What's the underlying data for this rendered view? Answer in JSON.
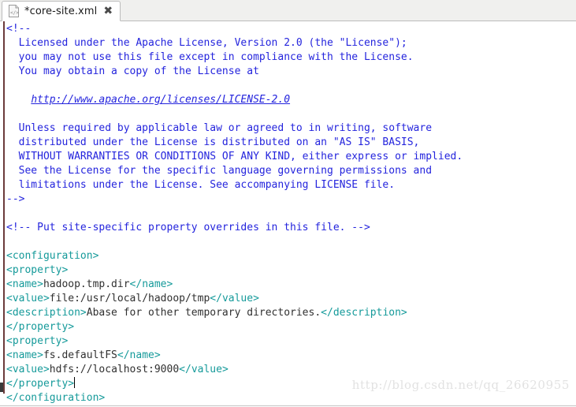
{
  "window": {
    "title": "*core-site.xml"
  },
  "tabbar": {
    "tab": {
      "label": "*core-site.xml",
      "icon": "xml-file-icon",
      "close_label": "✖",
      "modified": true
    }
  },
  "editor": {
    "language": "xml",
    "colors": {
      "comment": "#2424dd",
      "tag": "#159a9a",
      "text": "#303030",
      "link": "#2424dd",
      "background": "#ffffff",
      "gutter_rule": "#6b3b3b"
    },
    "lines": [
      {
        "n": 1,
        "segments": [
          {
            "cls": "cm",
            "t": "<!--"
          }
        ]
      },
      {
        "n": 2,
        "segments": [
          {
            "cls": "cm",
            "t": "  Licensed under the Apache License, Version 2.0 (the \"License\");"
          }
        ]
      },
      {
        "n": 3,
        "segments": [
          {
            "cls": "cm",
            "t": "  you may not use this file except in compliance with the License."
          }
        ]
      },
      {
        "n": 4,
        "segments": [
          {
            "cls": "cm",
            "t": "  You may obtain a copy of the License at"
          }
        ]
      },
      {
        "n": 5,
        "segments": [
          {
            "cls": "cm",
            "t": ""
          }
        ]
      },
      {
        "n": 6,
        "segments": [
          {
            "cls": "cm",
            "t": "    "
          },
          {
            "cls": "link",
            "t": "http://www.apache.org/licenses/LICENSE-2.0"
          }
        ]
      },
      {
        "n": 7,
        "segments": [
          {
            "cls": "cm",
            "t": ""
          }
        ]
      },
      {
        "n": 8,
        "segments": [
          {
            "cls": "cm",
            "t": "  Unless required by applicable law or agreed to in writing, software"
          }
        ]
      },
      {
        "n": 9,
        "segments": [
          {
            "cls": "cm",
            "t": "  distributed under the License is distributed on an \"AS IS\" BASIS,"
          }
        ]
      },
      {
        "n": 10,
        "segments": [
          {
            "cls": "cm",
            "t": "  WITHOUT WARRANTIES OR CONDITIONS OF ANY KIND, either express or implied."
          }
        ]
      },
      {
        "n": 11,
        "segments": [
          {
            "cls": "cm",
            "t": "  See the License for the specific language governing permissions and"
          }
        ]
      },
      {
        "n": 12,
        "segments": [
          {
            "cls": "cm",
            "t": "  limitations under the License. See accompanying LICENSE file."
          }
        ]
      },
      {
        "n": 13,
        "segments": [
          {
            "cls": "cm",
            "t": "-->"
          }
        ]
      },
      {
        "n": 14,
        "segments": [
          {
            "cls": "cm",
            "t": ""
          }
        ]
      },
      {
        "n": 15,
        "segments": [
          {
            "cls": "cm",
            "t": "<!-- Put site-specific property overrides in this file. -->"
          }
        ]
      },
      {
        "n": 16,
        "segments": [
          {
            "cls": "cm",
            "t": ""
          }
        ]
      },
      {
        "n": 17,
        "segments": [
          {
            "cls": "tag",
            "t": "<configuration>"
          }
        ]
      },
      {
        "n": 18,
        "segments": [
          {
            "cls": "tag",
            "t": "<property>"
          }
        ]
      },
      {
        "n": 19,
        "segments": [
          {
            "cls": "tag",
            "t": "<name>"
          },
          {
            "cls": "txt",
            "t": "hadoop.tmp.dir"
          },
          {
            "cls": "tag",
            "t": "</name>"
          }
        ]
      },
      {
        "n": 20,
        "segments": [
          {
            "cls": "tag",
            "t": "<value>"
          },
          {
            "cls": "txt",
            "t": "file:/usr/local/hadoop/tmp"
          },
          {
            "cls": "tag",
            "t": "</value>"
          }
        ]
      },
      {
        "n": 21,
        "segments": [
          {
            "cls": "tag",
            "t": "<description>"
          },
          {
            "cls": "txt",
            "t": "Abase for other temporary directories."
          },
          {
            "cls": "tag",
            "t": "</description>"
          }
        ]
      },
      {
        "n": 22,
        "segments": [
          {
            "cls": "tag",
            "t": "</property>"
          }
        ]
      },
      {
        "n": 23,
        "segments": [
          {
            "cls": "tag",
            "t": "<property>"
          }
        ]
      },
      {
        "n": 24,
        "segments": [
          {
            "cls": "tag",
            "t": "<name>"
          },
          {
            "cls": "txt",
            "t": "fs.defaultFS"
          },
          {
            "cls": "tag",
            "t": "</name>"
          }
        ]
      },
      {
        "n": 25,
        "segments": [
          {
            "cls": "tag",
            "t": "<value>"
          },
          {
            "cls": "txt",
            "t": "hdfs://localhost:9000"
          },
          {
            "cls": "tag",
            "t": "</value>"
          }
        ]
      },
      {
        "n": 26,
        "segments": [
          {
            "cls": "tag",
            "t": "</property>"
          }
        ],
        "caret_after": true
      },
      {
        "n": 27,
        "segments": [
          {
            "cls": "tag",
            "t": "</configuration>"
          }
        ]
      }
    ]
  },
  "watermark": {
    "text": "http://blog.csdn.net/qq_26620955"
  }
}
